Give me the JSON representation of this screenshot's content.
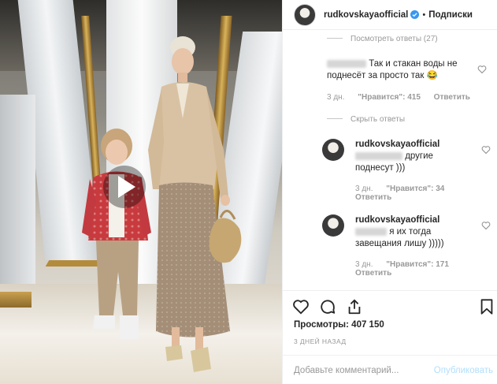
{
  "header": {
    "username": "rudkovskayaofficial",
    "separator": "•",
    "follow_label": "Подписки"
  },
  "comments": {
    "hidden_replies_label": "Посмотреть ответы (27)",
    "items": [
      {
        "text": "Так и стакан воды не поднесёт за просто так 😂",
        "time": "3 дн.",
        "likes": "\"Нравится\": 415",
        "reply_label": "Ответить"
      }
    ],
    "hide_replies_label": "Скрыть ответы",
    "replies": [
      {
        "username": "rudkovskayaofficial",
        "text_part": "другие поднесут )))",
        "time": "3 дн.",
        "likes": "\"Нравится\": 34",
        "reply_label": "Ответить"
      },
      {
        "username": "rudkovskayaofficial",
        "text_part": "я их тогда завещания лишу )))))",
        "time": "3 дн.",
        "likes": "\"Нравится\": 171",
        "reply_label": "Ответить"
      }
    ]
  },
  "stats": {
    "views_label": "Просмотры:",
    "views_value": "407 150",
    "date": "3 ДНЕЙ НАЗАД"
  },
  "add_comment": {
    "placeholder": "Добавьте комментарий...",
    "publish_label": "Опубликовать"
  },
  "icons": {
    "verified": "verified-badge-icon",
    "like": "heart-icon",
    "comment": "comment-icon",
    "share": "share-icon",
    "save": "bookmark-icon",
    "play": "play-icon"
  },
  "colors": {
    "verified": "#3897f0",
    "publish_disabled": "#b2dffc",
    "muted_text": "#999999"
  }
}
